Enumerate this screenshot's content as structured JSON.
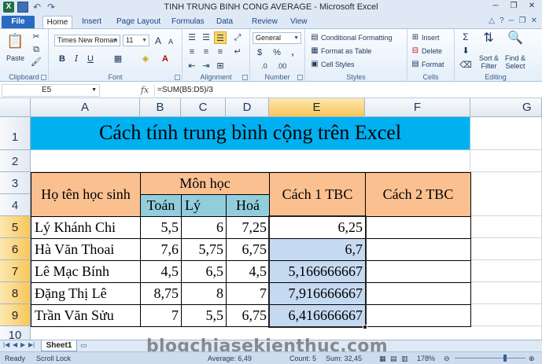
{
  "window": {
    "title": "TINH TRUNG BINH CONG AVERAGE - Microsoft Excel",
    "logo": "X"
  },
  "tabs": [
    "File",
    "Home",
    "Insert",
    "Page Layout",
    "Formulas",
    "Data",
    "Review",
    "View"
  ],
  "ribbon": {
    "clipboard": {
      "label": "Clipboard",
      "paste": "Paste"
    },
    "font": {
      "label": "Font",
      "name": "Times New Roman",
      "size": "11",
      "bold": "B",
      "italic": "I",
      "underline": "U",
      "grow": "A",
      "shrink": "A"
    },
    "alignment": {
      "label": "Alignment"
    },
    "number": {
      "label": "Number",
      "format": "General",
      "currency": "$",
      "percent": "%",
      "comma": ","
    },
    "styles": {
      "label": "Styles",
      "conditional": "Conditional Formatting",
      "table": "Format as Table",
      "cell": "Cell Styles"
    },
    "cells": {
      "label": "Cells",
      "insert": "Insert",
      "delete": "Delete",
      "format": "Format"
    },
    "editing": {
      "label": "Editing",
      "sort": "Sort &",
      "sort2": "Filter",
      "find": "Find &",
      "find2": "Select"
    }
  },
  "formula_bar": {
    "name_box": "E5",
    "fx": "fx",
    "formula": "=SUM(B5:D5)/3"
  },
  "columns": [
    "A",
    "B",
    "C",
    "D",
    "E",
    "F",
    "G"
  ],
  "rows": [
    "1",
    "2",
    "3",
    "4",
    "5",
    "6",
    "7",
    "8",
    "9",
    "10"
  ],
  "sheet": {
    "title": "Cách tính trung bình cộng trên Excel",
    "header_name": "Họ tên học sinh",
    "header_subjects": "Môn học",
    "subjects": [
      "Toán",
      "Lý",
      "Hoá"
    ],
    "header_cach1": "Cách 1 TBC",
    "header_cach2": "Cách 2 TBC",
    "data": [
      {
        "name": "Lý Khánh Chi",
        "toan": "5,5",
        "ly": "6",
        "hoa": "7,25",
        "tbc1": "6,25"
      },
      {
        "name": "Hà Văn Thoai",
        "toan": "7,6",
        "ly": "5,75",
        "hoa": "6,75",
        "tbc1": "6,7"
      },
      {
        "name": "Lê Mạc Bính",
        "toan": "4,5",
        "ly": "6,5",
        "hoa": "4,5",
        "tbc1": "5,166666667"
      },
      {
        "name": "Đặng Thị Lê",
        "toan": "8,75",
        "ly": "8",
        "hoa": "7",
        "tbc1": "7,916666667"
      },
      {
        "name": "Trần Văn Sửu",
        "toan": "7",
        "ly": "5,5",
        "hoa": "6,75",
        "tbc1": "6,416666667"
      }
    ]
  },
  "sheet_tabs": {
    "active": "Sheet1"
  },
  "status": {
    "ready": "Ready",
    "scroll_lock": "Scroll Lock",
    "average": "Average: 6,49",
    "count": "Count: 5",
    "sum": "Sum: 32,45",
    "zoom": "178%"
  },
  "watermark": "blogchiasekienthuc.com",
  "colors": {
    "title_fill": "#00b0f0",
    "header_fill": "#fac090",
    "subject_fill": "#92cddc",
    "selection_fill": "#c5d9f1"
  }
}
